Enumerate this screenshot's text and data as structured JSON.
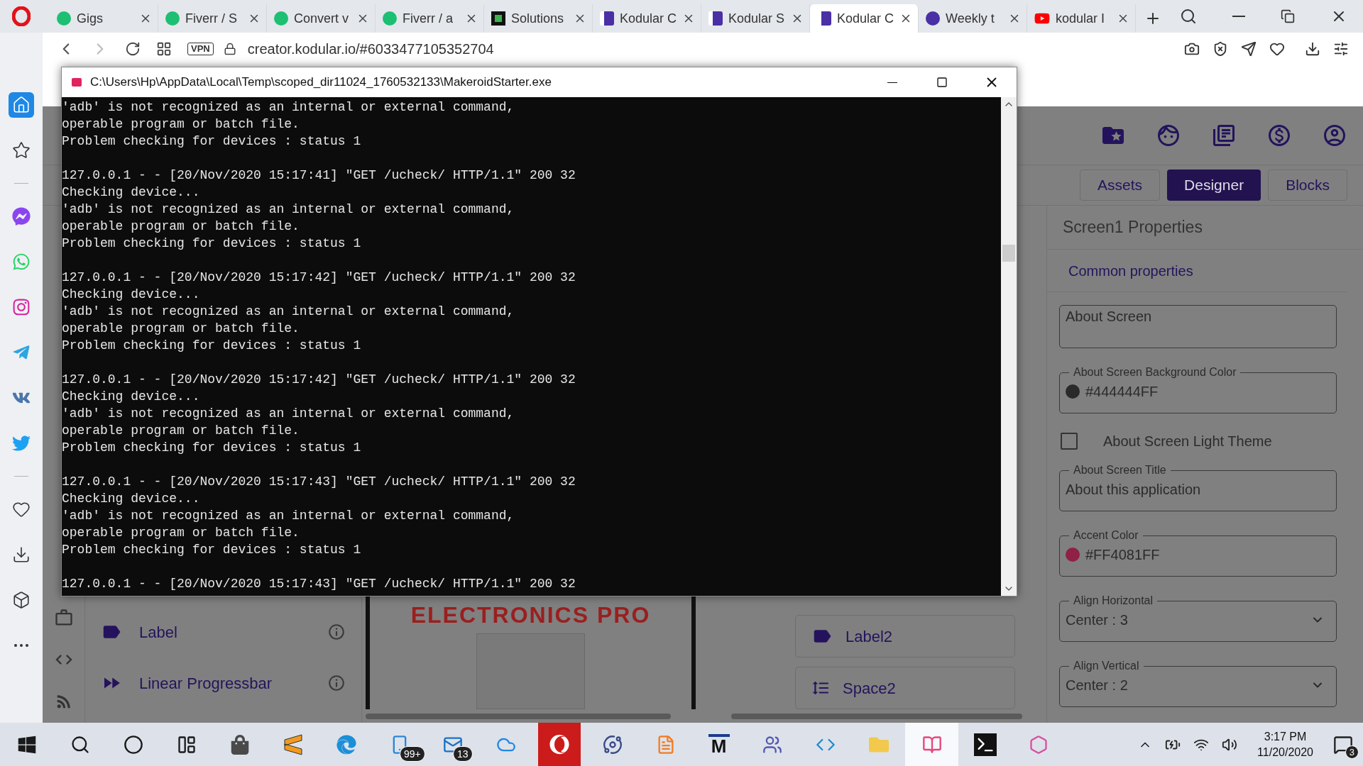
{
  "browser": {
    "tabs": [
      {
        "title": "Gigs",
        "kind": "fiverr",
        "selected": false
      },
      {
        "title": "Fiverr / S",
        "kind": "fiverr",
        "selected": false
      },
      {
        "title": "Convert v",
        "kind": "fiverr",
        "selected": false
      },
      {
        "title": "Fiverr / a",
        "kind": "fiverr",
        "selected": false
      },
      {
        "title": "Solutions",
        "kind": "solutions",
        "selected": false
      },
      {
        "title": "Kodular C",
        "kind": "kodular",
        "selected": false
      },
      {
        "title": "Kodular S",
        "kind": "kodular",
        "selected": false
      },
      {
        "title": "Kodular C",
        "kind": "kodular",
        "selected": true
      },
      {
        "title": "Weekly t",
        "kind": "kodular-round",
        "selected": false
      },
      {
        "title": "kodular I",
        "kind": "youtube",
        "selected": false
      }
    ],
    "vpn_badge": "VPN",
    "address": "creator.kodular.io/#6033477105352704",
    "sidebar": [
      {
        "kind": "home",
        "selected": true
      },
      {
        "kind": "star",
        "selected": false
      },
      {
        "kind": "divider"
      },
      {
        "kind": "messenger",
        "selected": false
      },
      {
        "kind": "whatsapp",
        "selected": false
      },
      {
        "kind": "instagram",
        "selected": false
      },
      {
        "kind": "telegram",
        "selected": false
      },
      {
        "kind": "vk",
        "selected": false
      },
      {
        "kind": "twitter",
        "selected": false
      },
      {
        "kind": "divider"
      },
      {
        "kind": "heart",
        "selected": false
      },
      {
        "kind": "download",
        "selected": false
      },
      {
        "kind": "box",
        "selected": false
      },
      {
        "kind": "more",
        "selected": false
      }
    ]
  },
  "console": {
    "title": "C:\\Users\\Hp\\AppData\\Local\\Temp\\scoped_dir11024_1760532133\\MakeroidStarter.exe",
    "blocks": [
      [
        "'adb' is not recognized as an internal or external command,",
        "operable program or batch file.",
        "Problem checking for devices : status 1"
      ],
      [
        "127.0.0.1 - - [20/Nov/2020 15:17:41] \"GET /ucheck/ HTTP/1.1\" 200 32",
        "Checking device...",
        "'adb' is not recognized as an internal or external command,",
        "operable program or batch file.",
        "Problem checking for devices : status 1"
      ],
      [
        "127.0.0.1 - - [20/Nov/2020 15:17:42] \"GET /ucheck/ HTTP/1.1\" 200 32",
        "Checking device...",
        "'adb' is not recognized as an internal or external command,",
        "operable program or batch file.",
        "Problem checking for devices : status 1"
      ],
      [
        "127.0.0.1 - - [20/Nov/2020 15:17:42] \"GET /ucheck/ HTTP/1.1\" 200 32",
        "Checking device...",
        "'adb' is not recognized as an internal or external command,",
        "operable program or batch file.",
        "Problem checking for devices : status 1"
      ],
      [
        "127.0.0.1 - - [20/Nov/2020 15:17:43] \"GET /ucheck/ HTTP/1.1\" 200 32",
        "Checking device...",
        "'adb' is not recognized as an internal or external command,",
        "operable program or batch file.",
        "Problem checking for devices : status 1"
      ],
      [
        "127.0.0.1 - - [20/Nov/2020 15:17:43] \"GET /ucheck/ HTTP/1.1\" 200 32"
      ]
    ]
  },
  "kodular": {
    "view_tabs": [
      {
        "label": "Assets",
        "selected": false
      },
      {
        "label": "Designer",
        "selected": true
      },
      {
        "label": "Blocks",
        "selected": false
      }
    ],
    "palette": [
      {
        "label": "Label",
        "kind": "label"
      },
      {
        "label": "Linear Progressbar",
        "kind": "progress"
      }
    ],
    "viewer_logo": "ELECTRONICS PRO",
    "components": [
      {
        "label": "Label2",
        "kind": "label"
      },
      {
        "label": "Space2",
        "kind": "space"
      }
    ],
    "properties": {
      "title": "Screen1 Properties",
      "section": "Common properties",
      "fields": [
        {
          "kind": "textarea",
          "value": "About Screen"
        },
        {
          "kind": "color",
          "label": "About Screen Background Color",
          "value": "#444444FF",
          "color": "#2a2a2a"
        },
        {
          "kind": "checkbox",
          "label": "About Screen Light Theme",
          "checked": false
        },
        {
          "kind": "text",
          "label": "About Screen Title",
          "value": "About this application"
        },
        {
          "kind": "color",
          "label": "Accent Color",
          "value": "#FF4081FF",
          "color": "#8f2046"
        },
        {
          "kind": "select",
          "label": "Align Horizontal",
          "value": "Center : 3"
        },
        {
          "kind": "select",
          "label": "Align Vertical",
          "value": "Center : 2"
        }
      ]
    }
  },
  "taskbar": {
    "apps": [
      {
        "kind": "start",
        "selected": false
      },
      {
        "kind": "search",
        "selected": false
      },
      {
        "kind": "cortana",
        "selected": false
      },
      {
        "kind": "taskview",
        "selected": false
      },
      {
        "kind": "store",
        "selected": false
      },
      {
        "kind": "sublime",
        "selected": false
      },
      {
        "kind": "edge",
        "selected": false
      },
      {
        "kind": "phone",
        "badge": "99+",
        "selected": false
      },
      {
        "kind": "mail",
        "badge": "13",
        "selected": false
      },
      {
        "kind": "onedrive",
        "selected": false
      },
      {
        "kind": "opera",
        "selected": false
      },
      {
        "kind": "orbit",
        "selected": false
      },
      {
        "kind": "pdf",
        "selected": false
      },
      {
        "kind": "letter",
        "label": "M",
        "selected": false
      },
      {
        "kind": "teams",
        "selected": false
      },
      {
        "kind": "vscode",
        "selected": false
      },
      {
        "kind": "explorer",
        "selected": false
      },
      {
        "kind": "book",
        "selected": true
      },
      {
        "kind": "terminal",
        "selected": false
      },
      {
        "kind": "hexagon",
        "selected": false
      }
    ],
    "time": "3:17 PM",
    "date": "11/20/2020",
    "notifications": "3"
  }
}
